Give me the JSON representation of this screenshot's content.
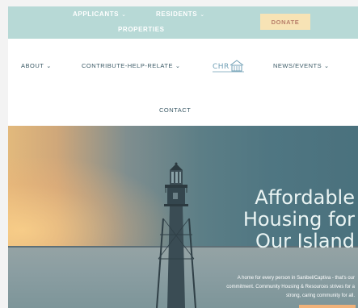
{
  "topbar": {
    "applicants": "APPLICANTS",
    "residents": "RESIDENTS",
    "properties": "PROPERTIES",
    "donate": "DONATE"
  },
  "nav": {
    "about": "ABOUT",
    "contribute": "CONTRIBUTE-HELP-RELATE",
    "logo_text": "CHR",
    "news": "NEWS/EVENTS",
    "contact": "CONTACT"
  },
  "hero": {
    "title_line1": "Affordable",
    "title_line2": "Housing for",
    "title_line3": "Our Island",
    "sub_line1": "A home for every person in Sanibel/Captiva - that's our",
    "sub_line2": "commitment. Community Housing & Resources strives for a",
    "sub_line3": "strong, caring community for all."
  },
  "colors": {
    "topbar": "#b7d9d6",
    "donate_bg": "#f7e3b5",
    "nav_text": "#3b5a66",
    "hero_text": "#eaf4f3"
  },
  "icons": {
    "chevron": "chevron-down-icon",
    "logo": "chr-logo-icon"
  }
}
